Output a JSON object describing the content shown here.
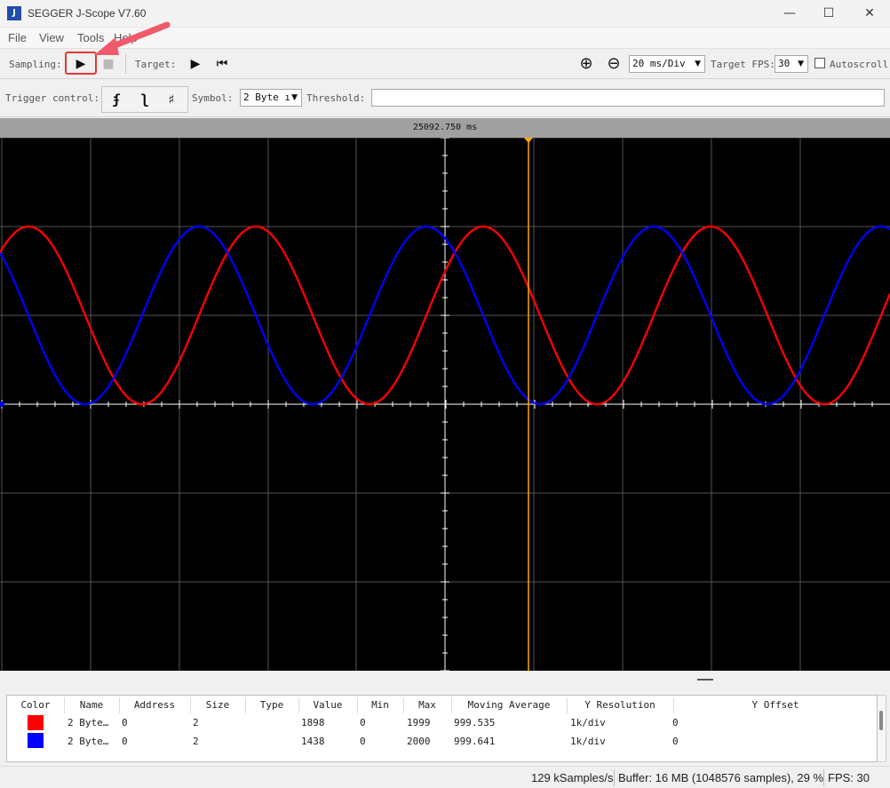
{
  "window": {
    "title": "SEGGER J-Scope V7.60",
    "app_icon_glyph": "J",
    "minimize_glyph": "—",
    "maximize_glyph": "☐",
    "close_glyph": "✕"
  },
  "menu": [
    "File",
    "View",
    "Tools",
    "Help"
  ],
  "toolbar": {
    "sampling_label": "Sampling:",
    "start_glyph": "▶",
    "stop_glyph": "■",
    "target_label": "Target:",
    "target_play_glyph": "▶",
    "target_reset_glyph": "⏮",
    "zoom_in_glyph": "⊕",
    "zoom_out_glyph": "⊖",
    "time_div_value": "20 ms/Div",
    "fps_label": "Target FPS:",
    "fps_value": "30",
    "autoscroll_label": "Autoscroll",
    "autoscroll_checked": false
  },
  "trigger": {
    "label": "Trigger control:",
    "rising_glyph": "ʄ",
    "falling_glyph": "ʅ",
    "both_glyph": "♯",
    "symbol_label": "Symbol:",
    "symbol_value": "2 Byte ı",
    "threshold_label": "Threshold:",
    "threshold_value": ""
  },
  "scope": {
    "time_readout": "25092.750 ms",
    "background": "#000000",
    "grid_color": "#555555",
    "axis_color": "#ffffff",
    "marker_color": "#ffa500",
    "cursor_fraction": 0.594
  },
  "channels_header": [
    "Color",
    "Name",
    "Address",
    "Size",
    "Type",
    "Value",
    "Min",
    "Max",
    "Moving Average",
    "Y Resolution",
    "Y Offset"
  ],
  "channels": [
    {
      "color": "#ff0000",
      "name": "2 Byte…",
      "address": "0",
      "size": "2",
      "type": "",
      "value": "1898",
      "min": "0",
      "max": "1999",
      "moving_average": "999.535",
      "y_resolution": "1k/div",
      "y_offset": "0"
    },
    {
      "color": "#0000ff",
      "name": "2 Byte…",
      "address": "0",
      "size": "2",
      "type": "",
      "value": "1438",
      "min": "0",
      "max": "2000",
      "moving_average": "999.641",
      "y_resolution": "1k/div",
      "y_offset": "0"
    }
  ],
  "status": {
    "sample_rate": "129 kSamples/s",
    "buffer": "Buffer: 16 MB (1048576 samples), 29 %",
    "fps": "FPS: 30"
  }
}
